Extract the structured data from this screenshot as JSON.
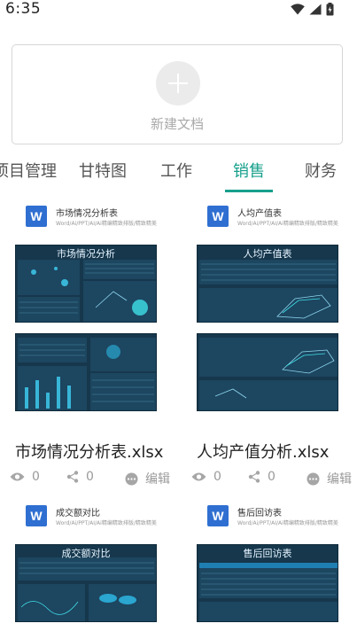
{
  "status_bar": {
    "time": "6:35"
  },
  "new_document": {
    "label": "新建文档"
  },
  "tabs": [
    {
      "label": "项目管理"
    },
    {
      "label": "甘特图"
    },
    {
      "label": "工作"
    },
    {
      "label": "销售"
    },
    {
      "label": "财务"
    }
  ],
  "active_tab": "销售",
  "cards": [
    {
      "subject": "市场情况分析表",
      "desc": "Word/Ai/PPT/AI/Ai精编精致排版/精致精美",
      "preview_title_top": "市场情况分析",
      "preview_title_bottom": "",
      "filename": "市场情况分析表.xlsx",
      "views": "0",
      "shares": "0",
      "edit_label": "编辑"
    },
    {
      "subject": "人均产值表",
      "desc": "Word/Ai/PPT/AI/Ai精编精致排版/精致精美",
      "preview_title_top": "人均产值表",
      "preview_title_bottom": "",
      "filename": "人均产值分析.xlsx",
      "views": "0",
      "shares": "0",
      "edit_label": "编辑"
    },
    {
      "subject": "成交额对比",
      "desc": "Word/Ai/PPT/AI/Ai精编精致排版/精致精美",
      "preview_title_top": "成交额对比",
      "preview_title_bottom": ""
    },
    {
      "subject": "售后回访表",
      "desc": "Word/Ai/PPT/AI/Ai精编精致排版/精致精美",
      "preview_title_top": "售后回访表",
      "preview_title_bottom": ""
    }
  ],
  "colors": {
    "accent": "#17a08c",
    "preview_bg": "#16374c",
    "word_blue": "#2f6fd1"
  }
}
